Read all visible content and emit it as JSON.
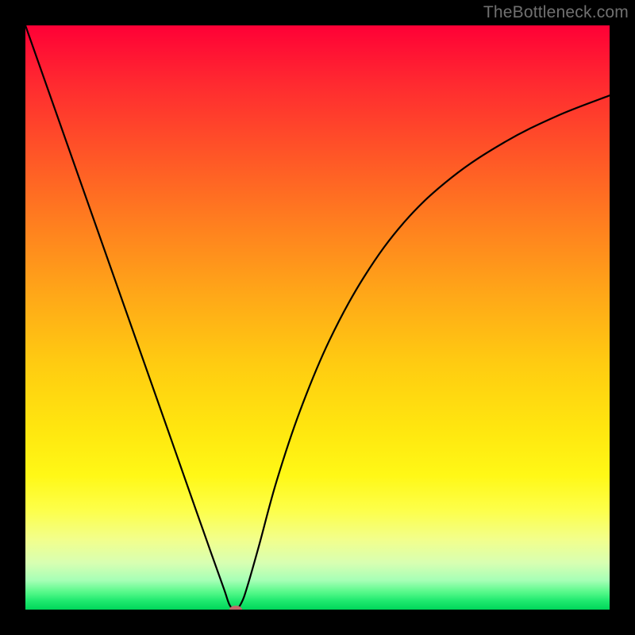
{
  "watermark": "TheBottleneck.com",
  "colors": {
    "frame": "#000000",
    "curve_stroke": "#000000",
    "marker_fill": "#c16a6b",
    "gradient_top": "#ff0036",
    "gradient_bottom": "#00d65a"
  },
  "chart_data": {
    "type": "line",
    "title": "",
    "xlabel": "",
    "ylabel": "",
    "xlim": [
      0,
      100
    ],
    "ylim": [
      0,
      100
    ],
    "grid": false,
    "background": "vertical gradient red→orange→yellow→green",
    "annotations": [
      {
        "text": "TheBottleneck.com",
        "pos": "top-right",
        "role": "watermark"
      }
    ],
    "series": [
      {
        "name": "curve",
        "color": "#000000",
        "x": [
          0,
          5,
          10,
          15,
          20,
          25,
          29,
          32,
          34,
          35,
          36,
          37,
          38,
          40,
          43,
          47,
          52,
          58,
          65,
          73,
          82,
          91,
          100
        ],
        "values": [
          100,
          85.8,
          71.6,
          57.4,
          43.2,
          29.0,
          17.6,
          9.1,
          3.5,
          0.7,
          0.0,
          1.2,
          4.0,
          11.0,
          22.0,
          34.0,
          46.0,
          57.0,
          66.5,
          74.0,
          80.0,
          84.5,
          88.0
        ]
      }
    ],
    "marker": {
      "x": 36,
      "y": 0,
      "color": "#c16a6b"
    }
  }
}
